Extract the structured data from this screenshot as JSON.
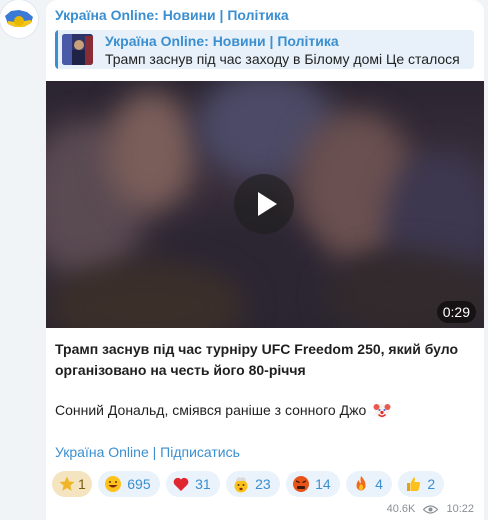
{
  "channel": {
    "name": "Україна Online: Новини | Політика"
  },
  "reply": {
    "title": "Україна Online: Новини | Політика",
    "text": "Трамп заснув під час заходу в Білому домі Це сталося"
  },
  "video": {
    "duration": "0:29"
  },
  "message": {
    "caption": "Трамп заснув під час турніру UFC Freedom 250, який було організовано на честь його 80-річчя",
    "subtext": "Сонний Дональд, сміявся раніше з сонного Джо",
    "subscribe_link": "Україна Online | Підписатись"
  },
  "reactions": [
    {
      "icon": "star-icon",
      "count": "1"
    },
    {
      "icon": "grin-face-icon",
      "count": "695"
    },
    {
      "icon": "heart-icon",
      "count": "31"
    },
    {
      "icon": "mind-blown-icon",
      "count": "23"
    },
    {
      "icon": "angry-face-icon",
      "count": "14"
    },
    {
      "icon": "fire-icon",
      "count": "4"
    },
    {
      "icon": "thumbs-up-icon",
      "count": "2"
    }
  ],
  "meta": {
    "views": "40.6K",
    "time": "10:22"
  },
  "colors": {
    "accent": "#3a8fd0",
    "reply_bg": "#e8f1fa",
    "reaction_bg": "#eaf2fb"
  }
}
